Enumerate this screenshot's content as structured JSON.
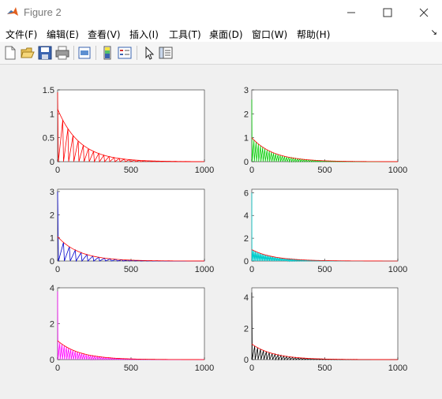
{
  "window": {
    "title": "Figure 2"
  },
  "menu": [
    "文件(F)",
    "编辑(E)",
    "查看(V)",
    "插入(I)",
    "工具(T)",
    "桌面(D)",
    "窗口(W)",
    "帮助(H)"
  ],
  "toolbar_icons": [
    "new-figure-icon",
    "open-file-icon",
    "save-icon",
    "print-icon",
    "print-preview-icon",
    "colorbar-icon",
    "legend-icon",
    "edit-plot-icon",
    "property-inspector-icon"
  ],
  "chart_data": [
    {
      "type": "line",
      "x_range": [
        0,
        1000
      ],
      "y_range": [
        0,
        1.5
      ],
      "xticks": [
        "0",
        "500",
        "1000"
      ],
      "yticks": [
        "0",
        "0.5",
        "1",
        "1.5"
      ],
      "color": "#ff0000",
      "decay_start": 1.1,
      "peak": 1.45,
      "spacing": 35
    },
    {
      "type": "line",
      "x_range": [
        0,
        1000
      ],
      "y_range": [
        0,
        3
      ],
      "xticks": [
        "0",
        "500",
        "1000"
      ],
      "yticks": [
        "0",
        "1",
        "2",
        "3"
      ],
      "color": "#00cc00",
      "decay_start": 1.0,
      "peak": 2.6,
      "spacing": 15
    },
    {
      "type": "line",
      "x_range": [
        0,
        1000
      ],
      "y_range": [
        0,
        3.1
      ],
      "xticks": [
        "0",
        "500",
        "1000"
      ],
      "yticks": [
        "0",
        "1",
        "2",
        "3"
      ],
      "color": "#0000cc",
      "decay_start": 1.05,
      "peak": 3.0,
      "spacing": 40
    },
    {
      "type": "line",
      "x_range": [
        0,
        1000
      ],
      "y_range": [
        0,
        6.3
      ],
      "xticks": [
        "0",
        "500",
        "1000"
      ],
      "yticks": [
        "0",
        "2",
        "4",
        "6"
      ],
      "color": "#00cccc",
      "decay_start": 1.0,
      "peak": 6.0,
      "spacing": 8
    },
    {
      "type": "line",
      "x_range": [
        0,
        1000
      ],
      "y_range": [
        0,
        4
      ],
      "xticks": [
        "0",
        "500",
        "1000"
      ],
      "yticks": [
        "0",
        "2",
        "4"
      ],
      "color": "#ff00ff",
      "decay_start": 1.05,
      "peak": 3.8,
      "spacing": 15
    },
    {
      "type": "line",
      "x_range": [
        0,
        1000
      ],
      "y_range": [
        0,
        4.6
      ],
      "xticks": [
        "0",
        "500",
        "1000"
      ],
      "yticks": [
        "0",
        "2",
        "4"
      ],
      "color": "#000000",
      "decay_start": 1.0,
      "peak": 4.3,
      "spacing": 20
    }
  ]
}
